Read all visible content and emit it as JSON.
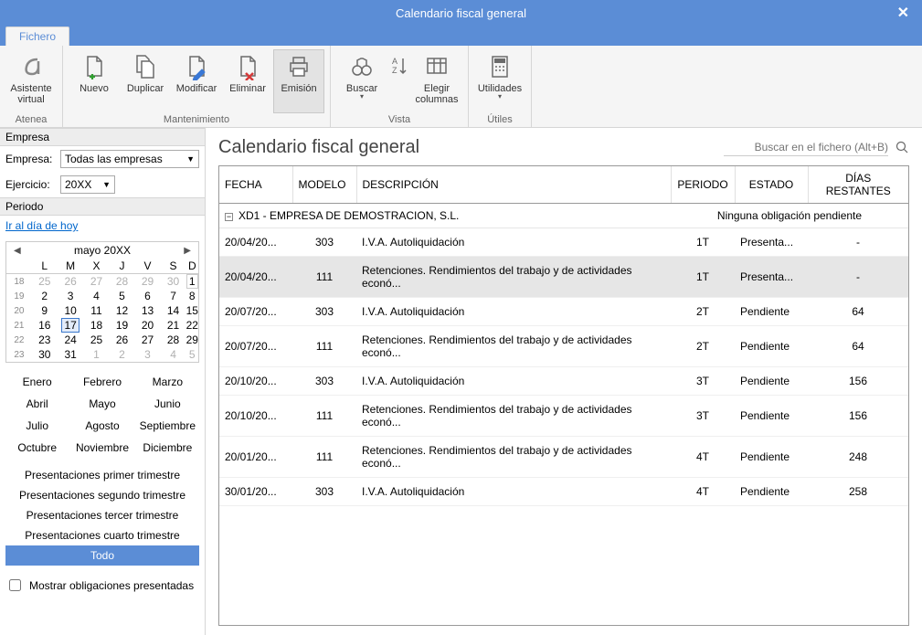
{
  "window": {
    "title": "Calendario fiscal general",
    "close_icon": "✕"
  },
  "tabs": {
    "file": "Fichero"
  },
  "ribbon": {
    "groups": [
      {
        "id": "atenea",
        "label": "Atenea",
        "buttons": [
          {
            "id": "asistente",
            "label": "Asistente\nvirtual",
            "icon": "alpha"
          }
        ]
      },
      {
        "id": "mant",
        "label": "Mantenimiento",
        "buttons": [
          {
            "id": "nuevo",
            "label": "Nuevo",
            "icon": "doc-plus"
          },
          {
            "id": "duplicar",
            "label": "Duplicar",
            "icon": "doc-dup"
          },
          {
            "id": "modificar",
            "label": "Modificar",
            "icon": "doc-edit"
          },
          {
            "id": "eliminar",
            "label": "Eliminar",
            "icon": "doc-del"
          },
          {
            "id": "emision",
            "label": "Emisión",
            "icon": "printer",
            "active": true
          }
        ]
      },
      {
        "id": "vista",
        "label": "Vista",
        "buttons": [
          {
            "id": "buscar",
            "label": "Buscar",
            "icon": "binoc",
            "dd": true
          },
          {
            "id": "sort",
            "label": "",
            "icon": "sort",
            "narrow": true
          },
          {
            "id": "columnas",
            "label": "Elegir\ncolumnas",
            "icon": "cols"
          }
        ]
      },
      {
        "id": "utiles",
        "label": "Útiles",
        "buttons": [
          {
            "id": "utilidades",
            "label": "Utilidades",
            "icon": "calc",
            "dd": true
          }
        ]
      }
    ]
  },
  "sidebar": {
    "empresa_head": "Empresa",
    "empresa_label": "Empresa:",
    "empresa_value": "Todas las empresas",
    "ejercicio_label": "Ejercicio:",
    "ejercicio_value": "20XX",
    "periodo_head": "Periodo",
    "today_link": "Ir al día de hoy",
    "calendar": {
      "title": "mayo  20XX",
      "dow": [
        "L",
        "M",
        "X",
        "J",
        "V",
        "S",
        "D"
      ],
      "weeks": [
        {
          "wk": "18",
          "days": [
            {
              "d": "25",
              "o": true
            },
            {
              "d": "26",
              "o": true
            },
            {
              "d": "27",
              "o": true
            },
            {
              "d": "28",
              "o": true
            },
            {
              "d": "29",
              "o": true
            },
            {
              "d": "30",
              "o": true
            },
            {
              "d": "1",
              "box": true
            }
          ]
        },
        {
          "wk": "19",
          "days": [
            {
              "d": "2"
            },
            {
              "d": "3"
            },
            {
              "d": "4"
            },
            {
              "d": "5"
            },
            {
              "d": "6"
            },
            {
              "d": "7"
            },
            {
              "d": "8"
            }
          ]
        },
        {
          "wk": "20",
          "days": [
            {
              "d": "9"
            },
            {
              "d": "10"
            },
            {
              "d": "11"
            },
            {
              "d": "12"
            },
            {
              "d": "13"
            },
            {
              "d": "14"
            },
            {
              "d": "15"
            }
          ]
        },
        {
          "wk": "21",
          "days": [
            {
              "d": "16"
            },
            {
              "d": "17",
              "today": true
            },
            {
              "d": "18"
            },
            {
              "d": "19"
            },
            {
              "d": "20"
            },
            {
              "d": "21"
            },
            {
              "d": "22"
            }
          ]
        },
        {
          "wk": "22",
          "days": [
            {
              "d": "23"
            },
            {
              "d": "24"
            },
            {
              "d": "25"
            },
            {
              "d": "26"
            },
            {
              "d": "27"
            },
            {
              "d": "28"
            },
            {
              "d": "29"
            }
          ]
        },
        {
          "wk": "23",
          "days": [
            {
              "d": "30"
            },
            {
              "d": "31"
            },
            {
              "d": "1",
              "o": true
            },
            {
              "d": "2",
              "o": true
            },
            {
              "d": "3",
              "o": true
            },
            {
              "d": "4",
              "o": true
            },
            {
              "d": "5",
              "o": true
            }
          ]
        }
      ]
    },
    "months": [
      "Enero",
      "Febrero",
      "Marzo",
      "Abril",
      "Mayo",
      "Junio",
      "Julio",
      "Agosto",
      "Septiembre",
      "Octubre",
      "Noviembre",
      "Diciembre"
    ],
    "presets": [
      "Presentaciones primer trimestre",
      "Presentaciones segundo trimestre",
      "Presentaciones tercer trimestre",
      "Presentaciones cuarto trimestre",
      "Todo"
    ],
    "preset_selected": 4,
    "checkbox_label": "Mostrar obligaciones presentadas"
  },
  "main": {
    "title": "Calendario fiscal general",
    "search_placeholder": "Buscar en el fichero (Alt+B)",
    "columns": [
      "FECHA",
      "MODELO",
      "DESCRIPCIÓN",
      "PERIODO",
      "ESTADO",
      "DÍAS RESTANTES"
    ],
    "group_label": "XD1 - EMPRESA DE DEMOSTRACION, S.L.",
    "group_status": "Ninguna obligación pendiente",
    "rows": [
      {
        "fecha": "20/04/20...",
        "modelo": "303",
        "desc": "I.V.A. Autoliquidación",
        "periodo": "1T",
        "estado": "Presenta...",
        "dias": "-"
      },
      {
        "fecha": "20/04/20...",
        "modelo": "111",
        "desc": "Retenciones. Rendimientos del trabajo y de actividades econó...",
        "periodo": "1T",
        "estado": "Presenta...",
        "dias": "-",
        "sel": true
      },
      {
        "fecha": "20/07/20...",
        "modelo": "303",
        "desc": "I.V.A. Autoliquidación",
        "periodo": "2T",
        "estado": "Pendiente",
        "dias": "64"
      },
      {
        "fecha": "20/07/20...",
        "modelo": "111",
        "desc": "Retenciones. Rendimientos del trabajo y de actividades econó...",
        "periodo": "2T",
        "estado": "Pendiente",
        "dias": "64"
      },
      {
        "fecha": "20/10/20...",
        "modelo": "303",
        "desc": "I.V.A. Autoliquidación",
        "periodo": "3T",
        "estado": "Pendiente",
        "dias": "156"
      },
      {
        "fecha": "20/10/20...",
        "modelo": "111",
        "desc": "Retenciones. Rendimientos del trabajo y de actividades econó...",
        "periodo": "3T",
        "estado": "Pendiente",
        "dias": "156"
      },
      {
        "fecha": "20/01/20...",
        "modelo": "111",
        "desc": "Retenciones. Rendimientos del trabajo y de actividades econó...",
        "periodo": "4T",
        "estado": "Pendiente",
        "dias": "248"
      },
      {
        "fecha": "30/01/20...",
        "modelo": "303",
        "desc": "I.V.A. Autoliquidación",
        "periodo": "4T",
        "estado": "Pendiente",
        "dias": "258"
      }
    ]
  }
}
